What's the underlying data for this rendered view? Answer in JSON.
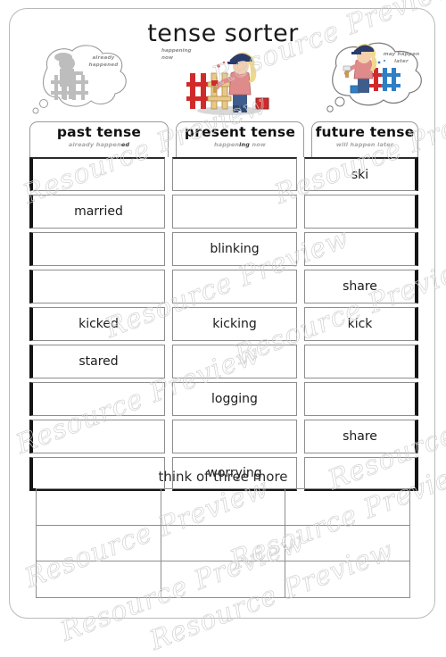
{
  "page": {
    "title": "tense sorter",
    "watermark_text": "Resource Preview",
    "bottom_prompt": "think of three more"
  },
  "illustrations": {
    "past_bubble": {
      "name": "past-thought-bubble",
      "label_line1": "already",
      "label_line2": "happened",
      "style": "grey silhouette of child painting a fence"
    },
    "present_art": {
      "name": "present-illustration",
      "label_line1": "happening",
      "label_line2": "now",
      "style": "colour drawing of child painting a red fence"
    },
    "future_bubble": {
      "name": "future-thought-bubble",
      "label_line1": "may happen",
      "label_line2": "later",
      "style": "colour drawing of child painting a blue fence inside a cloud"
    }
  },
  "columns": [
    {
      "heading": "past tense",
      "sub_prefix": "already happen",
      "sub_suffix": "ed"
    },
    {
      "heading": "present tense",
      "sub_prefix": "happen",
      "sub_suffix": "ing",
      "sub_tail": " now"
    },
    {
      "heading": "future tense",
      "sub_prefix": "will happen later",
      "sub_suffix": ""
    }
  ],
  "rows": [
    {
      "past": "",
      "present": "",
      "future": "ski"
    },
    {
      "past": "married",
      "present": "",
      "future": ""
    },
    {
      "past": "",
      "present": "blinking",
      "future": ""
    },
    {
      "past": "",
      "present": "",
      "future": "share"
    },
    {
      "past": "kicked",
      "present": "kicking",
      "future": "kick"
    },
    {
      "past": "stared",
      "present": "",
      "future": ""
    },
    {
      "past": "",
      "present": "logging",
      "future": ""
    },
    {
      "past": "",
      "present": "",
      "future": "share"
    },
    {
      "past": "",
      "present": "worrying",
      "future": ""
    }
  ],
  "bottom_grid": {
    "rows": 3,
    "columns": 3,
    "cells": [
      [
        "",
        "",
        ""
      ],
      [
        "",
        "",
        ""
      ],
      [
        "",
        "",
        ""
      ]
    ]
  },
  "colors": {
    "page_border": "#b9b9b9",
    "cell_border": "#8e8e8e",
    "cell_accent": "#141414",
    "text": "#1b1b1b",
    "sub_text": "#a5a5a5",
    "watermark": "#cfcfcf"
  }
}
